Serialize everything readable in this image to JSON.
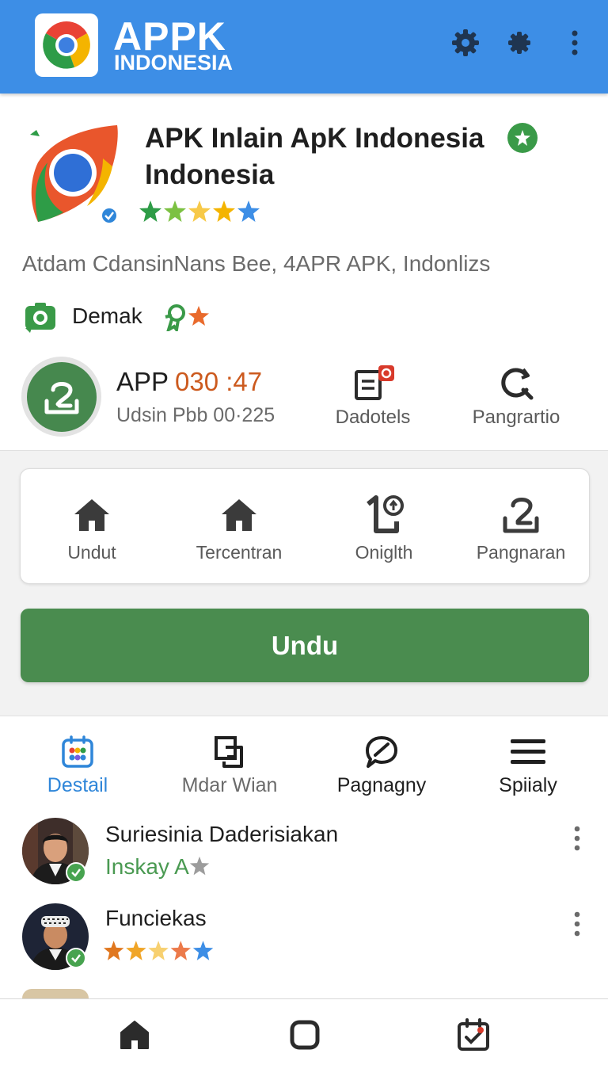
{
  "top_bar": {
    "brand_line_1": "APPK",
    "brand_line_2": "INDONESIA",
    "icons": [
      "settings-icon",
      "bug-icon",
      "more-vertical-icon"
    ]
  },
  "app": {
    "title": "APK Inlain ApK Indonesia Indonesia",
    "rating_stars": 5,
    "description": "Atdam CdansinNans Bee, 4APR APK, Indonlizs",
    "developer": "Demak"
  },
  "stats": {
    "app_label": "APP",
    "app_value": "030 :47",
    "app_subtext": "Udsin Pbb 00·225",
    "details_label": "Dadotels",
    "search_label": "Pangrartio"
  },
  "quick_actions": [
    {
      "label": "Undut",
      "icon": "home-icon"
    },
    {
      "label": "Tercentran",
      "icon": "home-icon"
    },
    {
      "label": "Oniglth",
      "icon": "device-icon"
    },
    {
      "label": "Pangnaran",
      "icon": "download-icon"
    }
  ],
  "download_button": "Undu",
  "tabs": [
    {
      "label": "Destail",
      "icon": "grid-icon",
      "active": true
    },
    {
      "label": "Mdar Wian",
      "icon": "copy-icon",
      "active": false
    },
    {
      "label": "Pagnagny",
      "icon": "chat-icon",
      "active": false
    },
    {
      "label": "Spiialy",
      "icon": "menu-icon",
      "active": false
    }
  ],
  "reviews": [
    {
      "name": "Suriesinia Daderisiakan",
      "subtitle": "Inskay A"
    },
    {
      "name": "Funciekas",
      "stars": 5
    }
  ],
  "colors": {
    "top_bar": "#3d8ee6",
    "primary_green": "#4a8c4f",
    "accent_orange": "#cc5a1e",
    "active_tab": "#2f86d9"
  },
  "bottom_nav": [
    "home-icon",
    "square-icon",
    "calendar-check-icon"
  ]
}
